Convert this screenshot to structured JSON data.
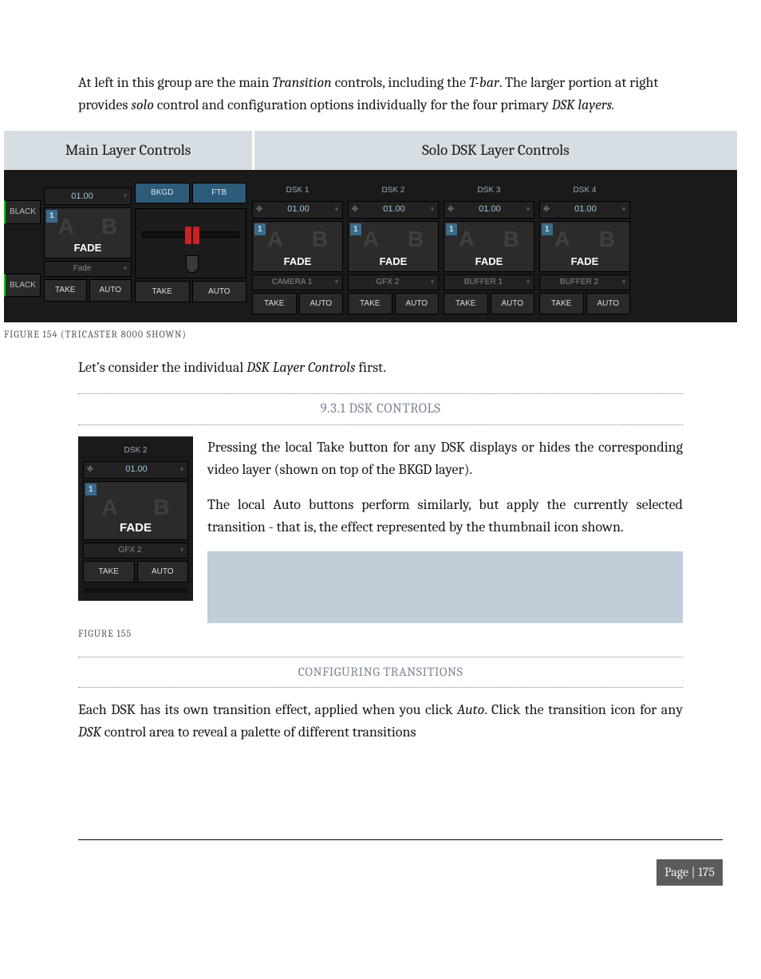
{
  "intro": {
    "prefix": "At left in this group are the main ",
    "transition": "Transition",
    "mid1": " controls, including the ",
    "tbar": "T-bar",
    "mid2": ".  The larger portion at right provides ",
    "solo": "solo",
    "mid3": " control and configuration options individually for the four primary ",
    "dsk": "DSK layers."
  },
  "labels": {
    "main": "Main Layer Controls",
    "solo": "Solo DSK Layer Controls"
  },
  "main_ui": {
    "black": "BLACK",
    "time": "01.00",
    "fade": "FADE",
    "fade_sel": "Fade",
    "bkgd": "BKGD",
    "ftb": "FTB",
    "take": "TAKE",
    "auto": "AUTO",
    "corner": "1"
  },
  "dsks": [
    {
      "title": "DSK 1",
      "time": "01.00",
      "fade": "FADE",
      "sel": "CAMERA 1",
      "take": "TAKE",
      "auto": "AUTO"
    },
    {
      "title": "DSK 2",
      "time": "01.00",
      "fade": "FADE",
      "sel": "GFX 2",
      "take": "TAKE",
      "auto": "AUTO"
    },
    {
      "title": "DSK 3",
      "time": "01.00",
      "fade": "FADE",
      "sel": "BUFFER 1",
      "take": "TAKE",
      "auto": "AUTO"
    },
    {
      "title": "DSK 4",
      "time": "01.00",
      "fade": "FADE",
      "sel": "BUFFER 2",
      "take": "TAKE",
      "auto": "AUTO"
    }
  ],
  "fig154": "FIGURE 154 (TRICASTER 8000 SHOWN)",
  "lets": {
    "prefix": "Let’s consider the individual ",
    "it": "DSK Layer Controls",
    "suffix": " first."
  },
  "section931": "9.3.1 DSK CONTROLS",
  "side": {
    "title": "DSK 2",
    "time": "01.00",
    "fade": "FADE",
    "sel": "GFX 2",
    "take": "TAKE",
    "auto": "AUTO"
  },
  "right": {
    "p1a": "Pressing the local ",
    "p1_take": "Take",
    "p1b": " button for any ",
    "p1_dsk": "DSK",
    "p1c": " displays or hides the corresponding video layer (shown on top of the ",
    "p1_bkgd": "BKGD",
    "p1d": " layer).",
    "p2a": "The local ",
    "p2_auto": "Auto",
    "p2b": " buttons perform similarly, but apply the currently selected transition - that is, the effect represented by the thumbnail icon shown."
  },
  "fig155": "FIGURE 155",
  "configuring": "CONFIGURING TRANSITIONS",
  "bottom": {
    "a": "Each DSK has its own transition effect, applied when you click ",
    "auto": "Auto",
    "b": ".  Click the transition icon for any ",
    "dsk": "DSK",
    "c": " control area to reveal a palette of different transitions"
  },
  "page": "Page | 175"
}
